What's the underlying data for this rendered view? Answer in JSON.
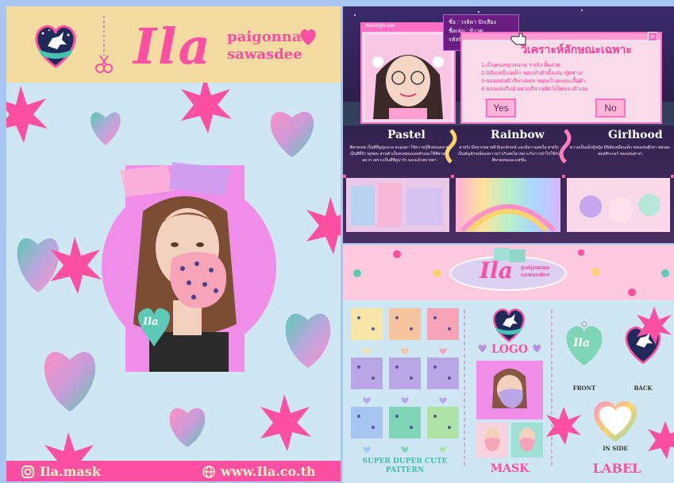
{
  "poster": {
    "brand": "Ila",
    "tagline_line1": "paigonna",
    "tagline_line2": "sawasdee",
    "mask_tag_brand": "Ila",
    "footer_social": "Ila.mask",
    "footer_website": "www.Ila.co.th",
    "colors": {
      "pink": "#ff4fa3",
      "cream": "#f3dba2",
      "sky": "#cfe7f2",
      "violet": "#f08de8"
    }
  },
  "showcase": {
    "window_tag": "moonlight.exe",
    "id_card": {
      "name_line": "ชื่อ : วรธิดา ปักเสียง",
      "nick_line": "ชื่อเล่น : ข้าวตู",
      "id_line": "รหัสนิสิต : 62130010092"
    },
    "dialog": {
      "title": "วิเคราะห์ลักษณะเฉพาะ",
      "items": [
        "1.เป็นคนสนุกสนาน ร่าเริง ยิ้มง่าย",
        "2.นิสัยเหมือนเด็ก ชอบทำตัวตั้งเล่น ซุ่มซ่าม",
        "3.ชอบแต่งตัวสีพาสเทล ชอบเก็บตะดมเสื้อผ้า",
        "4.ชอบเล่นรีมส์ อยากมีสวนสัตว์เป็นของตัวเอง"
      ],
      "yes_label": "Yes",
      "no_label": "No"
    },
    "categories": [
      {
        "title": "Pastel",
        "desc": "สีพาสเทล เป็นสีที่ดูนุ่มนวล ละมุนตา ให้ความรู้สึกผ่อนคลาย เป็นสีที่ข้าวตูชอบ ส่วนตัวเป็นคนชอบแต่งตัวและใช้สีพาสเทลมาก เพราะเป็นสีที่ดูน่ารัก มองแล้วสบายตา"
      },
      {
        "title": "Rainbow",
        "desc": "สายรุ้ง มีหลากหลายสี มีเอกลักษณ์ และมีความสดใส สายรุ้งเป็นสัญลักษณ์ของความร่าเริงสดใส เหมาะกับการนำไปใช้กับสีพาสเทลและแฟชั่น"
      },
      {
        "title": "Girlhood",
        "desc": "ความเป็นเด็กผู้หญิง มีนิสัยเหมือนเด็ก ชอบเล่นตุ๊กตา ชอบสะสมสติกเกอร์ ของเล่นต่างๆ"
      }
    ]
  },
  "brandboard": {
    "brand": "Ila",
    "tagline_line1": "paigonna",
    "tagline_line2": "sawasdee",
    "pattern_label_line1": "SUPER DUPER CUTE",
    "pattern_label_line2": "PATTERN",
    "logo_label": "LOGO",
    "mask_label": "MASK",
    "label_label": "LABEL",
    "label_front": "FRONT",
    "label_back": "BACK",
    "label_inside": "IN SIDE",
    "label_tag_brand": "Ila"
  }
}
